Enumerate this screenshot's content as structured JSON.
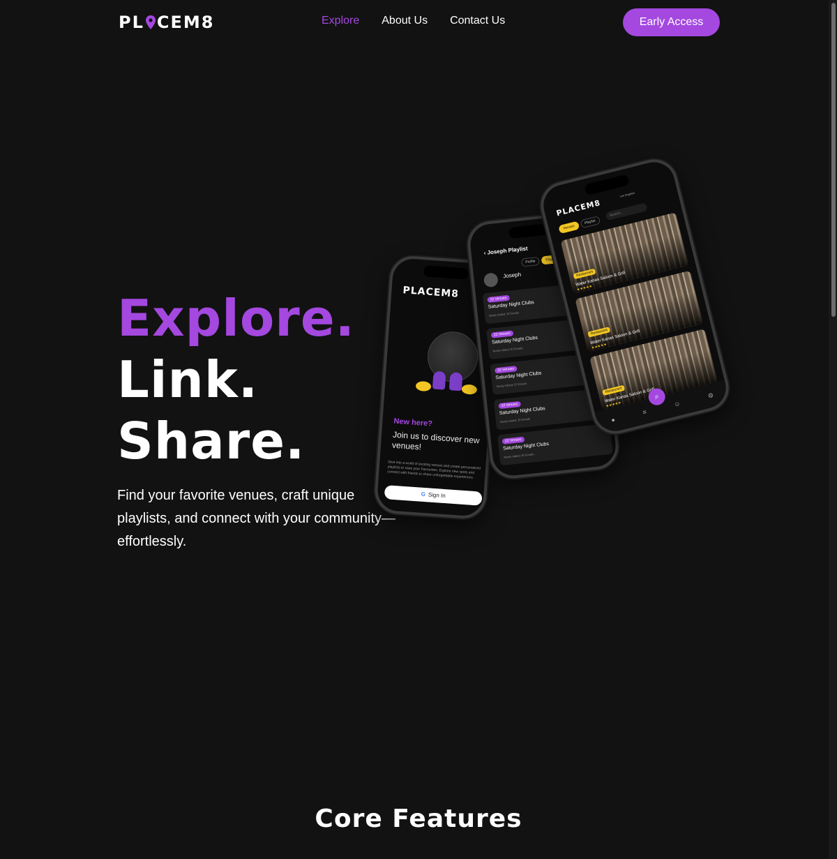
{
  "nav": {
    "logo": "PLACEM8",
    "links": [
      "Explore",
      "About Us",
      "Contact Us"
    ],
    "cta": "Early Access"
  },
  "hero": {
    "line1": "Explore.",
    "line2": "Link.",
    "line3": "Share.",
    "description": "Find your favorite venues, craft unique playlists, and connect with your community—effortlessly."
  },
  "mockups": {
    "phone1": {
      "logo": "PLACEM8",
      "heading": "New here?",
      "subheading": "Join us to discover new venues!",
      "body": "Dive into a world of exciting venues and create personalized playlists to save your Favourites. Explore new spots and connect with friends to share unforgettable experiences.",
      "button": "Sign In"
    },
    "phone2": {
      "title": "Joseph Playlist",
      "tabs": [
        "Profile",
        "Playlist"
      ],
      "user": "Joseph",
      "cards": [
        {
          "badge": "22 Venues",
          "title": "Saturday Night Clubs",
          "sub": "Newly Added: El Dorado"
        },
        {
          "badge": "22 Venues",
          "title": "Saturday Night Clubs",
          "sub": "Newly Added: El Dorado"
        },
        {
          "badge": "22 Venues",
          "title": "Saturday Night Clubs",
          "sub": "Newly Added: El Dorado"
        },
        {
          "badge": "22 Venues",
          "title": "Saturday Night Clubs",
          "sub": "Newly Added: El Dorado"
        },
        {
          "badge": "22 Venues",
          "title": "Saturday Night Clubs",
          "sub": "Newly Added: El Dorado"
        }
      ]
    },
    "phone3": {
      "logo": "PLACEM8",
      "location": "Los Angeles",
      "tabs": [
        "Venues",
        "Playlist"
      ],
      "search_placeholder": "Search...",
      "cards": [
        {
          "tag": "Restaurant",
          "name": "Water Kanas Saloon & Grill",
          "stars": "★★★★★"
        },
        {
          "tag": "Restaurant",
          "name": "Water Kanas Saloon & Grill",
          "stars": "★★★★★"
        },
        {
          "tag": "Restaurant",
          "name": "Water Kanas Saloon & Grill",
          "stars": "★★★★★"
        }
      ],
      "bottom_nav": [
        "map-pin-icon",
        "list-icon",
        "users-icon",
        "gear-icon"
      ]
    }
  },
  "core_features": {
    "title": "Core Features"
  },
  "colors": {
    "accent": "#a448e0",
    "background": "#121212",
    "yellow": "#f3c623"
  }
}
